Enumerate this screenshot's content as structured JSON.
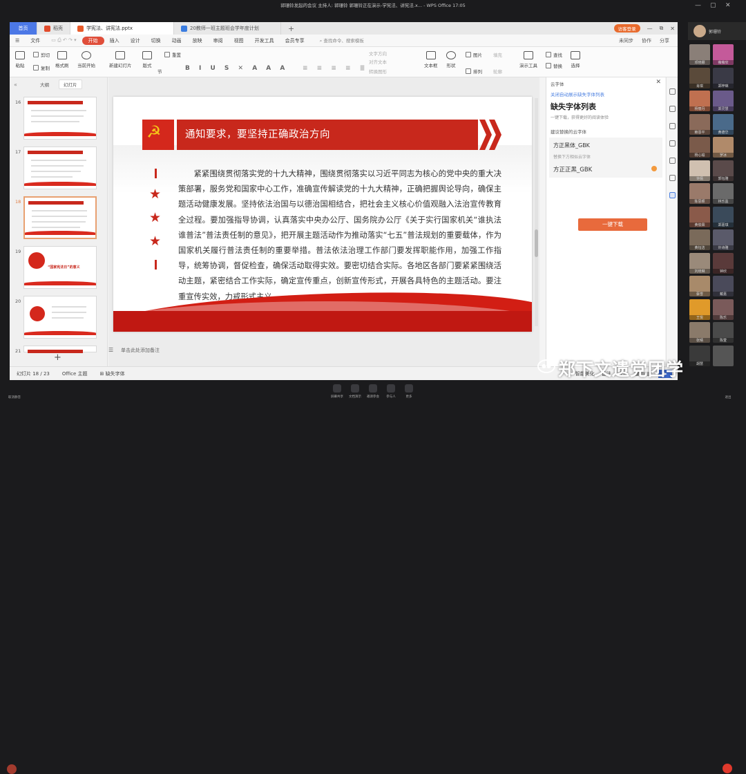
{
  "meeting": {
    "title": "郭珊铃发起的会议  主持人: 郭珊铃  郭珊铃正在演示-学宪法、讲宪法.x... - WPS Office  17:05",
    "self_name": "郭珊铃",
    "toolbar": [
      {
        "label": "屏幕共享"
      },
      {
        "label": "文档演示"
      },
      {
        "label": "邀请参会"
      },
      {
        "label": "参与人"
      },
      {
        "label": "更多"
      }
    ],
    "left_label": "取消静音",
    "right_label": "退出"
  },
  "wps": {
    "tabs": {
      "home": "首页",
      "t1": "稻壳",
      "t2": "学宪法、讲宪法.pptx",
      "t3": "20教师一班主题班会学年度计划"
    },
    "login": "访客登录",
    "menu": {
      "file": "文件",
      "items": [
        "开始",
        "插入",
        "设计",
        "切换",
        "动画",
        "放映",
        "审阅",
        "视图",
        "开发工具",
        "会员专享"
      ],
      "search": "查找命令、搜索模板",
      "right": [
        "未同步",
        "协作",
        "分享"
      ]
    },
    "ribbon": {
      "paste": "粘贴",
      "cut": "剪切",
      "copy": "复制",
      "format_painter": "格式刷",
      "from_current": "当前开始",
      "new_slide": "新建幻灯片",
      "layout": "版式",
      "section": "节",
      "reset": "重置",
      "text_box": "文本框",
      "shape": "形状",
      "arrange": "排列",
      "outline": "轮廓",
      "picture": "图片",
      "fill": "填充",
      "slideshow": "演示工具",
      "find": "查找",
      "replace": "替换",
      "select": "选择",
      "text_direction": "文字方向",
      "align_text": "对齐文本",
      "convert_smartart": "转换图形"
    },
    "left_panel": {
      "tab_outline": "大纲",
      "tab_slides": "幻灯片",
      "slide_numbers": [
        "16",
        "17",
        "18",
        "19",
        "20",
        "21"
      ],
      "thumb19_text": "“国家宪法日”的意义"
    },
    "slide": {
      "title": "通知要求，要坚持正确政治方向",
      "body": "紧紧围绕贯彻落实党的十九大精神，围绕贯彻落实以习近平同志为核心的党中央的重大决策部署，服务党和国家中心工作，准确宣传解读党的十九大精神，正确把握舆论导向，确保主题活动健康发展。坚持依法治国与以德治国相结合，把社会主义核心价值观融入法治宣传教育全过程。要加强指导协调，认真落实中央办公厅、国务院办公厅《关于实行国家机关“谁执法谁普法”普法责任制的意见》，把开展主题活动作为推动落实“七五”普法规划的重要载体，作为国家机关履行普法责任制的重要举措。普法依法治理工作部门要发挥职能作用，加强工作指导，统筹协调，督促检查，确保活动取得实效。要密切结合实际。各地区各部门要紧紧围绕活动主题，紧密结合工作实际，确定宣传重点，创新宣传形式，开展各具特色的主题活动。要注重宣传实效，力戒形式主义。"
    },
    "notes_placeholder": "单击此处添加备注",
    "right_panel": {
      "header": "云字体",
      "link": "关闭自动展示缺失字体列表",
      "title": "缺失字体列表",
      "subtitle": "一键下载，获得更好的阅读体验",
      "section": "建议替换的云字体",
      "font1": "方正黑体_GBK",
      "hint": "替换下方相似云字体",
      "font2": "方正正黑_GBK",
      "download": "一键下载"
    },
    "status": {
      "slide_counter": "幻灯片 18 / 23",
      "theme": "Office 主题",
      "missing_fonts": "缺失字体",
      "smart_beautify": "智能美化",
      "notes": "备注",
      "comments": "批注"
    }
  },
  "watermark": "郑下文遗党团学",
  "participants": [
    {
      "name": "邓晓娜",
      "color": "#8a7f78"
    },
    {
      "name": "薇薇欣",
      "color": "#c45a9a"
    },
    {
      "name": "肖琪",
      "color": "#5a4a3a"
    },
    {
      "name": "郑梓琳",
      "color": "#3a3a46"
    },
    {
      "name": "杨丽丹",
      "color": "#c07050"
    },
    {
      "name": "郑灵慧",
      "color": "#6a5a8a"
    },
    {
      "name": "赖恩平",
      "color": "#8a6a5a"
    },
    {
      "name": "黄德华",
      "color": "#4a6a8a"
    },
    {
      "name": "杨心瑜",
      "color": "#7a5a4a"
    },
    {
      "name": "罗冰",
      "color": "#b08a6a"
    },
    {
      "name": "许倩",
      "color": "#d0c0b0"
    },
    {
      "name": "郭钰雅",
      "color": "#5a4a4a"
    },
    {
      "name": "陈思颖",
      "color": "#9a7a6a"
    },
    {
      "name": "林乐盈",
      "color": "#6a6a6a"
    },
    {
      "name": "黄俊霖",
      "color": "#8a5a4a"
    },
    {
      "name": "郑嘉琪",
      "color": "#3a4a5a"
    },
    {
      "name": "黄钰洁",
      "color": "#7a6a5a"
    },
    {
      "name": "许诗雅",
      "color": "#5a5a6a"
    },
    {
      "name": "刘晓琳",
      "color": "#9a8a7a"
    },
    {
      "name": "钟欣",
      "color": "#5a3a3a"
    },
    {
      "name": "蔡雪",
      "color": "#a88a6a"
    },
    {
      "name": "戴嘉",
      "color": "#4a4a5a"
    },
    {
      "name": "王悦",
      "color": "#e09a2a"
    },
    {
      "name": "陈乐",
      "color": "#7a5a5a"
    },
    {
      "name": "张晴",
      "color": "#8a7a6a"
    },
    {
      "name": "陈萱",
      "color": "#4a4a4a"
    },
    {
      "name": "胡慧",
      "color": "#3a3a3a"
    },
    {
      "name": "",
      "color": "#555555"
    }
  ]
}
